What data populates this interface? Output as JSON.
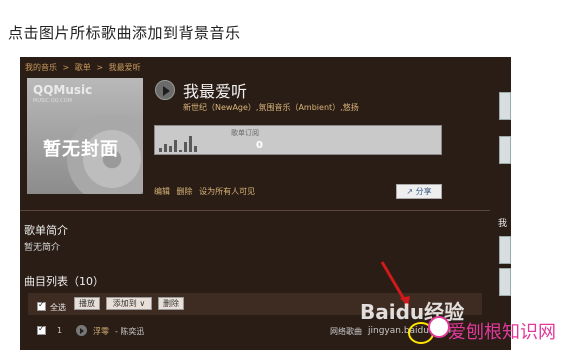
{
  "instruction": "点击图片所标歌曲添加到背景音乐",
  "breadcrumb": [
    "我的音乐",
    ">",
    "歌单",
    ">",
    "我最爱听"
  ],
  "cover": {
    "logo": "QQMusic",
    "logo_sub": "MUSIC.QQ.COM",
    "placeholder": "暂无封面"
  },
  "playlist": {
    "title": "我最爱听",
    "tags": "新世纪（NewAge）,氛围音乐（Ambient）,悠扬",
    "stat_label": "歌单订阅",
    "stat_value": "0",
    "activity_level": [
      2,
      4,
      3,
      6,
      1,
      5,
      8,
      3
    ]
  },
  "actions": {
    "edit": "编辑",
    "delete": "删除",
    "set_visible": "设为所有人可见",
    "share": "分享"
  },
  "intro": {
    "title": "歌单简介",
    "text": "暂无简介"
  },
  "songlist": {
    "title": "曲目列表（10）"
  },
  "toolbar": {
    "select_all": "全选",
    "play": "播放",
    "add_to": "添加到",
    "remove": "删除"
  },
  "songs": [
    {
      "index": "1",
      "name": "浮零",
      "artist": "- 陈奕迅",
      "source": "网络歌曲"
    }
  ],
  "right_panel": {
    "label": "我"
  },
  "watermark": {
    "brand": "Baidu经验",
    "url": "jingyan.baidu.com"
  },
  "site_logo": "爱刨根知识网",
  "colors": {
    "panel_bg": "#2a1d16",
    "link": "#d9b57a",
    "highlight": "#ffe600",
    "site": "#e0399a"
  }
}
